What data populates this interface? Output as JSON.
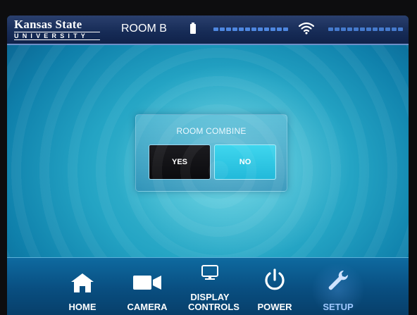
{
  "header": {
    "logo_top": "Kansas State",
    "logo_bottom": "UNIVERSITY",
    "room_name": "ROOM B",
    "icons": [
      "battery-icon",
      "signal-strength-icon",
      "wifi-icon"
    ]
  },
  "dialog": {
    "title": "ROOM COMBINE",
    "yes_label": "YES",
    "no_label": "NO",
    "selected": "YES"
  },
  "nav": {
    "items": [
      {
        "label": "HOME",
        "icon": "home-icon"
      },
      {
        "label": "CAMERA",
        "icon": "camera-icon"
      },
      {
        "label": "DISPLAY CONTROLS",
        "icon": "monitor-icon"
      },
      {
        "label": "POWER",
        "icon": "power-icon"
      },
      {
        "label": "SETUP",
        "icon": "wrench-icon",
        "active": true
      }
    ]
  },
  "colors": {
    "header_bg": "#162b56",
    "screen_bg": "#24a4c4",
    "yes_button": "#0b0b0e",
    "no_button": "#22b9da",
    "nav_bg": "#094e80",
    "active_nav_label": "#9fc8ff"
  }
}
